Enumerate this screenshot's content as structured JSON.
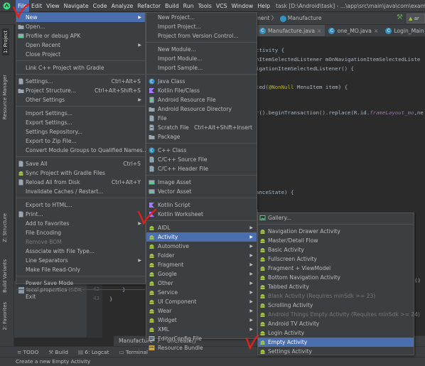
{
  "app_title": "task [D:\\Android\\task] - ...\\app\\src\\main\\java\\com\\example\\",
  "menubar": [
    "File",
    "Edit",
    "View",
    "Navigate",
    "Code",
    "Analyze",
    "Refactor",
    "Build",
    "Run",
    "Tools",
    "VCS",
    "Window",
    "Help"
  ],
  "breadcrumb": {
    "part1": "agment",
    "sep": "〉",
    "part2": "Manufacture"
  },
  "run_config": "ar",
  "tabs": [
    {
      "label": "Manufacture.java",
      "active": true
    },
    {
      "label": "one_MO.java",
      "active": false
    },
    {
      "label": "Login_Main",
      "active": false
    }
  ],
  "tool_windows_left": [
    "1: Project",
    "Resource Manager",
    "Z: Structure",
    "Build Variants",
    "2: Favorites"
  ],
  "code_lines": {
    "l1": "ctivity {",
    "l2": "nItemSelectedListener mOnNavigationItemSelectedListe",
    "l3": "igationItemSelectedListener() {",
    "l4a": "ted(",
    "l4b": "@NonNull",
    "l4c": " MenuItem item) {",
    "l5a": "r().beginTransaction().replace(R.id.",
    "l5b": "frameLayout_mo",
    "l5c": ",ne",
    "l6": "anceState) {",
    "l7": ";",
    "l8": "()"
  },
  "project_panel": {
    "item": "local.properties",
    "item_suffix": "(SDK"
  },
  "gutter_lines": [
    "42",
    "43"
  ],
  "editor_braces": [
    "}",
    "}"
  ],
  "navbar": {
    "class_name": "Manufacture",
    "sep": "〉",
    "method": "onCreate()"
  },
  "bottom_tabs": [
    "TODO",
    "Build",
    "6: Logcat",
    "Terminal"
  ],
  "status_text": "Create a new Empty Activity",
  "file_menu": [
    {
      "label": "New",
      "submenu": true,
      "highlighted": true
    },
    {
      "label": "Open..."
    },
    {
      "label": "Profile or debug APK"
    },
    {
      "label": "Open Recent",
      "submenu": true
    },
    {
      "label": "Close Project"
    },
    {
      "sep": true
    },
    {
      "label": "Link C++ Project with Gradle"
    },
    {
      "sep": true
    },
    {
      "label": "Settings...",
      "shortcut": "Ctrl+Alt+S"
    },
    {
      "label": "Project Structure...",
      "shortcut": "Ctrl+Alt+Shift+S"
    },
    {
      "label": "Other Settings",
      "submenu": true
    },
    {
      "sep": true
    },
    {
      "label": "Import Settings..."
    },
    {
      "label": "Export Settings..."
    },
    {
      "label": "Settings Repository..."
    },
    {
      "label": "Export to Zip File..."
    },
    {
      "label": "Convert Module Groups to Qualified Names..."
    },
    {
      "sep": true
    },
    {
      "label": "Save All",
      "shortcut": "Ctrl+S"
    },
    {
      "label": "Sync Project with Gradle Files"
    },
    {
      "label": "Reload All from Disk",
      "shortcut": "Ctrl+Alt+Y"
    },
    {
      "label": "Invalidate Caches / Restart..."
    },
    {
      "sep": true
    },
    {
      "label": "Export to HTML..."
    },
    {
      "label": "Print..."
    },
    {
      "label": "Add to Favorites",
      "submenu": true
    },
    {
      "label": "File Encoding"
    },
    {
      "label": "Remove BOM",
      "disabled": true
    },
    {
      "label": "Associate with File Type..."
    },
    {
      "label": "Line Separators",
      "submenu": true
    },
    {
      "label": "Make File Read-Only"
    },
    {
      "sep": true
    },
    {
      "label": "Power Save Mode"
    },
    {
      "sep": true
    },
    {
      "label": "Exit"
    }
  ],
  "new_menu": [
    {
      "label": "New Project..."
    },
    {
      "label": "Import Project..."
    },
    {
      "label": "Project from Version Control..."
    },
    {
      "sep": true
    },
    {
      "label": "New Module..."
    },
    {
      "label": "Import Module..."
    },
    {
      "label": "Import Sample..."
    },
    {
      "sep": true
    },
    {
      "label": "Java Class",
      "icon": "java-class"
    },
    {
      "label": "Kotlin File/Class",
      "icon": "kotlin"
    },
    {
      "label": "Android Resource File",
      "icon": "resource"
    },
    {
      "label": "Android Resource Directory",
      "icon": "folder"
    },
    {
      "label": "File",
      "icon": "file"
    },
    {
      "label": "Scratch File",
      "shortcut": "Ctrl+Alt+Shift+Insert",
      "icon": "scratch"
    },
    {
      "label": "Package",
      "icon": "folder"
    },
    {
      "sep": true
    },
    {
      "label": "C++ Class",
      "icon": "cpp"
    },
    {
      "label": "C/C++ Source File",
      "icon": "cpp-file"
    },
    {
      "label": "C/C++ Header File",
      "icon": "cpp-file"
    },
    {
      "sep": true
    },
    {
      "label": "Image Asset",
      "icon": "image"
    },
    {
      "label": "Vector Asset",
      "icon": "image"
    },
    {
      "sep": true
    },
    {
      "label": "Kotlin Script",
      "icon": "kotlin"
    },
    {
      "label": "Kotlin Worksheet",
      "icon": "kotlin"
    },
    {
      "sep": true
    },
    {
      "label": "AIDL",
      "submenu": true,
      "icon": "android"
    },
    {
      "label": "Activity",
      "submenu": true,
      "highlighted": true,
      "icon": "android"
    },
    {
      "label": "Automotive",
      "submenu": true,
      "icon": "android"
    },
    {
      "label": "Folder",
      "submenu": true,
      "icon": "android"
    },
    {
      "label": "Fragment",
      "submenu": true,
      "icon": "android"
    },
    {
      "label": "Google",
      "submenu": true,
      "icon": "android"
    },
    {
      "label": "Other",
      "submenu": true,
      "icon": "android"
    },
    {
      "label": "Service",
      "submenu": true,
      "icon": "android"
    },
    {
      "label": "UI Component",
      "submenu": true,
      "icon": "android"
    },
    {
      "label": "Wear",
      "submenu": true,
      "icon": "android"
    },
    {
      "label": "Widget",
      "submenu": true,
      "icon": "android"
    },
    {
      "label": "XML",
      "submenu": true,
      "icon": "android"
    },
    {
      "label": "EditorConfig File",
      "icon": "editorconfig"
    },
    {
      "label": "Resource Bundle",
      "icon": "bundle"
    }
  ],
  "activity_menu": [
    {
      "label": "Gallery...",
      "icon": "gallery"
    },
    {
      "sep": true
    },
    {
      "label": "Navigation Drawer Activity"
    },
    {
      "label": "Master/Detail Flow"
    },
    {
      "label": "Basic Activity"
    },
    {
      "label": "Fullscreen Activity"
    },
    {
      "label": "Fragment + ViewModel"
    },
    {
      "label": "Bottom Navigation Activity"
    },
    {
      "label": "Tabbed Activity"
    },
    {
      "label": "Blank Activity (Requires minSdk >= 23)",
      "disabled": true
    },
    {
      "label": "Scrolling Activity"
    },
    {
      "label": "Android Things Empty Activity (Requires minSdk >= 24)",
      "disabled": true
    },
    {
      "label": "Android TV Activity"
    },
    {
      "label": "Login Activity"
    },
    {
      "label": "Empty Activity",
      "highlighted": true
    },
    {
      "label": "Settings Activity"
    }
  ],
  "colors": {
    "accent": "#4b6eaf",
    "android_green": "#a4c639",
    "annotation_red": "#e0201b"
  }
}
